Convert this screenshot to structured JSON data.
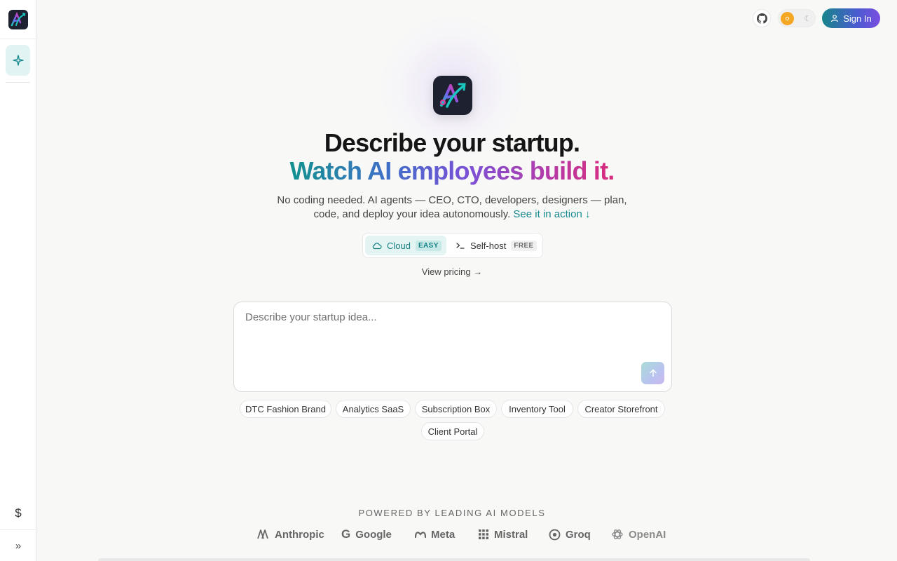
{
  "sidebar": {
    "logo": "app-logo",
    "new_icon": "sparkle-icon",
    "pricing_icon": "dollar-icon",
    "expand_icon": "chevrons-right-icon"
  },
  "topbar": {
    "github_icon": "github-icon",
    "theme_light_icon": "sun-icon",
    "theme_dark_icon": "moon-icon",
    "signin_label": "Sign In"
  },
  "hero": {
    "title_line1": "Describe your startup.",
    "title_line2": "Watch AI employees build it.",
    "subtitle": "No coding needed. AI agents — CEO, CTO, developers, designers — plan, code, and deploy your idea autonomously.",
    "see_action": "See it in action ↓",
    "gradient_colors": [
      "#12928f",
      "#3f70c8",
      "#7a50d6",
      "#b73aa8",
      "#d92b7b"
    ]
  },
  "modes": {
    "cloud": {
      "label": "Cloud",
      "badge": "EASY"
    },
    "selfhost": {
      "label": "Self-host",
      "badge": "FREE"
    }
  },
  "pricing_link": "View pricing →",
  "prompt": {
    "placeholder": "Describe your startup idea...",
    "value": ""
  },
  "suggestions": [
    "DTC Fashion Brand",
    "Analytics SaaS",
    "Subscription Box",
    "Inventory Tool",
    "Creator Storefront",
    "Client Portal"
  ],
  "powered_by": {
    "heading": "POWERED BY LEADING AI MODELS",
    "models": [
      "Anthropic",
      "Google",
      "Meta",
      "Mistral",
      "Groq",
      "OpenAI"
    ]
  },
  "colors": {
    "accent": "#168a8d",
    "signin_gradient": [
      "#16858a",
      "#7b4fe0"
    ]
  }
}
